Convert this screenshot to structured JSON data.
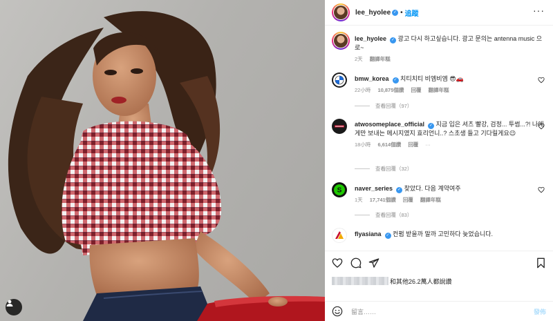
{
  "post": {
    "username": "lee_hyolee",
    "follow_label": "追蹤",
    "caption_user": "lee_hyolee",
    "caption": "광고 다시 하고싶습니다. 광고 문의는 antenna music 으로~",
    "age": "2天",
    "translate": "翻譯年糕"
  },
  "comments": [
    {
      "user": "bmw_korea",
      "text": "치티치티 비엠비엠 😎🚗",
      "time": "22小時",
      "likes": "10,875個讚",
      "reply": "回覆",
      "translate": "翻譯年糕",
      "view_replies": "查看回覆（97）",
      "avatar_icon": "bmw-logo-icon"
    },
    {
      "user": "atwosomeplace_official",
      "text": "지금 입은 셔츠 빨강, 검정... 투썸...?! 나에게만 보내는 메시지였지 효리언니..? 스초생 들고 기다릴게요😉",
      "time": "18小時",
      "likes": "6,614個讚",
      "reply": "回覆",
      "view_replies": "查看回覆（32）",
      "avatar_icon": "twosome-logo-icon"
    },
    {
      "user": "naver_series",
      "text": "찾았다. 다음 계약여주",
      "time": "1天",
      "likes": "17,741個讚",
      "reply": "回覆",
      "translate": "翻譯年糕",
      "view_replies": "查看回覆（83）",
      "avatar_icon": "naver-series-logo-icon"
    },
    {
      "user": "flyasiana",
      "text": "컨펌 받을까 말까 고민하다 늦었습니다.",
      "avatar_icon": "asiana-logo-icon"
    }
  ],
  "likes_line": {
    "suffix": "和其他26.2萬人都說讚"
  },
  "add_comment": {
    "placeholder": "留言……",
    "post_label": "發佈"
  },
  "colors": {
    "accent": "#0095f6",
    "verified": "#3897f0",
    "muted": "#8e8e8e"
  }
}
